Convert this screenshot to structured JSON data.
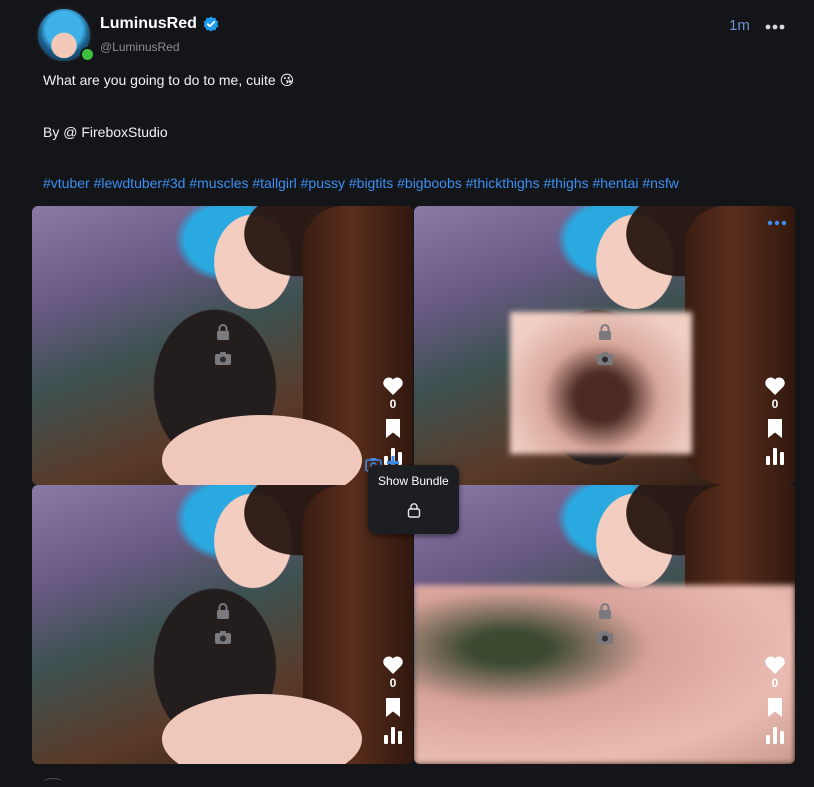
{
  "author": {
    "display_name": "LuminusRed",
    "handle": "@LuminusRed",
    "verified": true,
    "online": true,
    "time_ago": "1m"
  },
  "post": {
    "text": "What are you going to do to me, cuite 😘",
    "credit": "By @ FireboxStudio",
    "hashtags": [
      "#vtuber",
      "#lewdtuber",
      "#3d",
      "#muscles",
      "#tallgirl",
      "#pussy",
      "#bigtits",
      "#bigboobs",
      "#thickthighs",
      "#thighs",
      "#hentai",
      "#nsfw"
    ]
  },
  "media": [
    {
      "likes": "0",
      "blurred": false
    },
    {
      "likes": "0",
      "blurred": true
    },
    {
      "likes": "0",
      "blurred": false
    },
    {
      "likes": "0",
      "blurred": true
    }
  ],
  "bundle": {
    "tooltip_label": "Show Bundle"
  },
  "colors": {
    "background": "#141519",
    "link": "#3b8ff0",
    "verified": "#1d9bf0",
    "online": "#3fbf3f",
    "time": "#6f8fd0"
  },
  "icons": [
    "verified-badge-icon",
    "more-icon",
    "lock-icon",
    "camera-icon",
    "heart-icon",
    "bookmark-icon",
    "stats-icon",
    "plus-icon"
  ]
}
